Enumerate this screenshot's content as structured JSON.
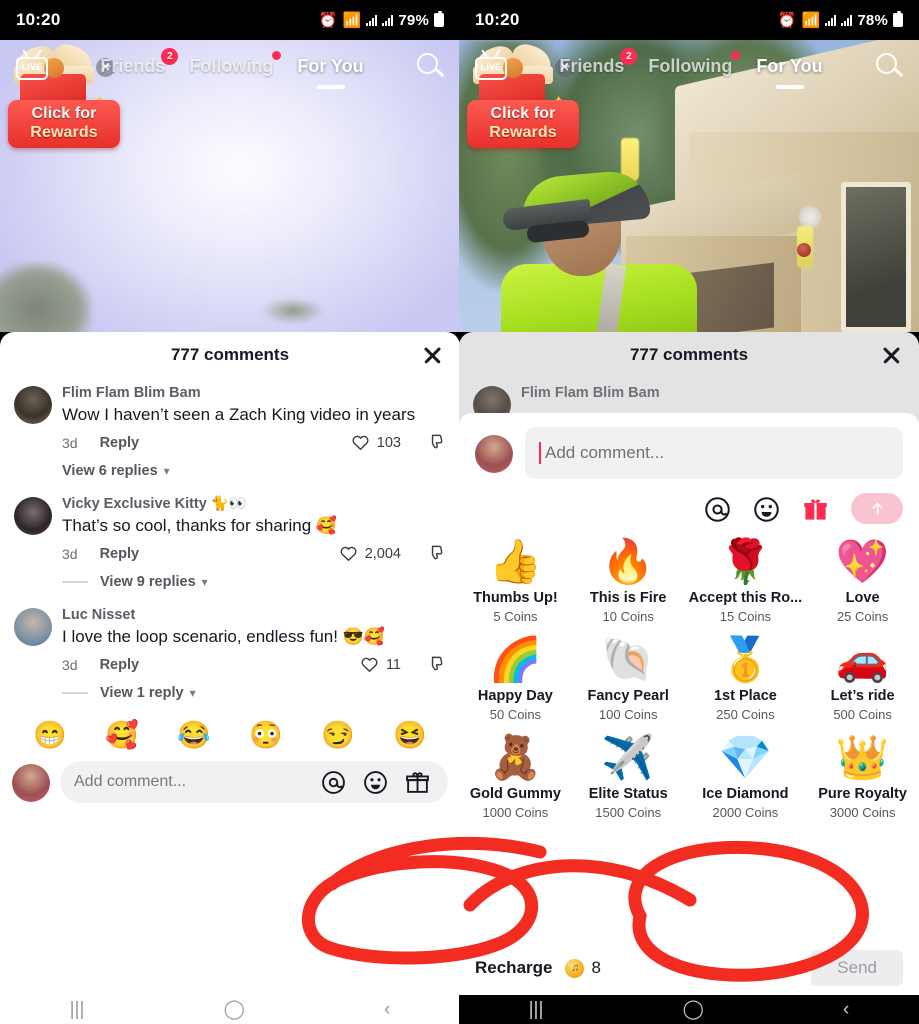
{
  "app": {
    "name": "TikTok"
  },
  "panels": [
    {
      "id": "left",
      "statusbar": {
        "time": "10:20",
        "battery": "79%",
        "icons": [
          "alarm-icon",
          "wifi-icon",
          "signal-icon",
          "signal-icon",
          "battery-icon"
        ]
      },
      "topnav": {
        "live_label": "LIVE",
        "tabs": [
          {
            "label": "Friends",
            "badge": "2",
            "active": false
          },
          {
            "label": "Following",
            "dot": true,
            "active": false
          },
          {
            "label": "For You",
            "active": true
          }
        ],
        "search_icon": "search-icon"
      },
      "reward_widget": {
        "line1": "Click for",
        "line2": "Rewards",
        "close_icon": "close-icon"
      },
      "sheet": {
        "title": "777 comments",
        "close_icon": "close-icon",
        "dimmed": false,
        "comments": [
          {
            "name": "Flim Flam Blim Bam",
            "text": "Wow I haven’t seen a Zach King video in years",
            "time": "3d",
            "reply": "Reply",
            "likes": "103",
            "replies_label": "View 6 replies"
          },
          {
            "name": "Vicky Exclusive Kitty 🐈​👀",
            "text": "That’s so cool, thanks for sharing 🥰",
            "time": "3d",
            "reply": "Reply",
            "likes": "2,004",
            "replies_label": "View 9 replies"
          },
          {
            "name": "Luc Nisset",
            "text": "I love the loop scenario, endless fun! 😎🥰",
            "time": "3d",
            "reply": "Reply",
            "likes": "11",
            "replies_label": "View 1 reply"
          }
        ],
        "quick_emojis": [
          "😁",
          "🥰",
          "😂",
          "😳",
          "😏",
          "😆"
        ],
        "comment_bar": {
          "placeholder": "Add comment...",
          "actions": [
            "mention-icon",
            "emoji-icon",
            "gift-icon"
          ]
        }
      },
      "bottomnav": {
        "theme": "white",
        "buttons": [
          "recents-icon",
          "home-icon",
          "back-icon"
        ]
      }
    },
    {
      "id": "right",
      "statusbar": {
        "time": "10:20",
        "battery": "78%",
        "icons": [
          "alarm-icon",
          "wifi-icon",
          "signal-icon",
          "signal-icon",
          "battery-icon"
        ]
      },
      "topnav": {
        "live_label": "LIVE",
        "tabs": [
          {
            "label": "Friends",
            "badge": "2",
            "active": false
          },
          {
            "label": "Following",
            "dot": true,
            "active": false
          },
          {
            "label": "For You",
            "active": true
          }
        ],
        "search_icon": "search-icon"
      },
      "reward_widget": {
        "line1": "Click for",
        "line2": "Rewards",
        "close_icon": "close-icon"
      },
      "sheet": {
        "title": "777 comments",
        "close_icon": "close-icon",
        "dimmed": true,
        "partial_comment_name": "Flim Flam Blim Bam"
      },
      "compose": {
        "caret": true,
        "placeholder": "Add comment...",
        "actions": [
          "mention-icon",
          "emoji-icon",
          "gift-icon"
        ],
        "send_arrow_icon": "arrow-up-icon"
      },
      "gifts": [
        {
          "art": "👍",
          "name": "Thumbs Up!",
          "cost": "5 Coins"
        },
        {
          "art": "🔥",
          "name": "This is Fire",
          "cost": "10 Coins"
        },
        {
          "art": "🌹",
          "name": "Accept this Ro...",
          "cost": "15 Coins"
        },
        {
          "art": "💖",
          "name": "Love",
          "cost": "25 Coins"
        },
        {
          "art": "🌈",
          "name": "Happy Day",
          "cost": "50 Coins"
        },
        {
          "art": "🐚",
          "name": "Fancy Pearl",
          "cost": "100 Coins"
        },
        {
          "art": "🥇",
          "name": "1st Place",
          "cost": "250 Coins"
        },
        {
          "art": "🚗",
          "name": "Let’s ride",
          "cost": "500 Coins"
        },
        {
          "art": "🧸",
          "name": "Gold Gummy",
          "cost": "1000 Coins"
        },
        {
          "art": "✈️",
          "name": "Elite Status",
          "cost": "1500 Coins"
        },
        {
          "art": "💎",
          "name": "Ice Diamond",
          "cost": "2000 Coins"
        },
        {
          "art": "👑",
          "name": "Pure Royalty",
          "cost": "3000 Coins"
        }
      ],
      "recharge": {
        "label": "Recharge",
        "coin_icon": "coin-icon",
        "amount": "8",
        "send_label": "Send"
      },
      "bottomnav": {
        "theme": "black",
        "buttons": [
          "recents-icon",
          "home-icon",
          "back-icon"
        ]
      }
    }
  ],
  "annotations": {
    "color": "#f22c20",
    "shapes": [
      {
        "name": "circle-comment-actions"
      },
      {
        "name": "circle-recharge-balance"
      }
    ]
  }
}
